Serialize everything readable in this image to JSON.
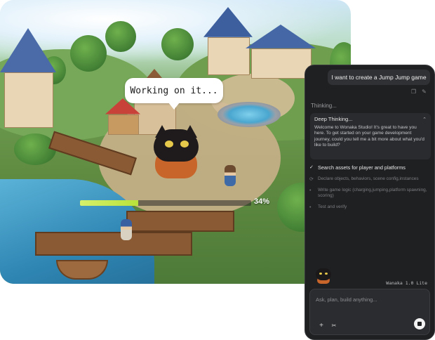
{
  "game": {
    "speech_bubble": "Working on it...",
    "progress": {
      "value_percent": 34,
      "label": "34%"
    },
    "colors": {
      "progress_fill": "#c4e84c",
      "panel_bg": "#1f2022"
    }
  },
  "chat": {
    "user_message": "I want to create a Jump Jump game",
    "action_icons": [
      "copy-icon",
      "edit-icon"
    ],
    "thinking_label": "Thinking...",
    "deep_thinking": {
      "title": "Deep Thinking...",
      "text": "Welcome to Wonaka Studio! It's great to have you here. To get started on your game development journey, could you tell me a bit more about what you'd like to build?"
    },
    "steps": [
      {
        "status": "done",
        "text": "Search assets for player and platforms"
      },
      {
        "status": "pending",
        "text": "Declare objects, behaviors, scene config,instances"
      },
      {
        "status": "pending",
        "text": "Write game logic (charging,jumping,platform spawning, scoring)"
      },
      {
        "status": "pending",
        "text": "Test and verify"
      }
    ],
    "model_label": "Wanaka 1.0 Lite",
    "input": {
      "placeholder": "Ask, plan, build anything...",
      "value": ""
    }
  }
}
